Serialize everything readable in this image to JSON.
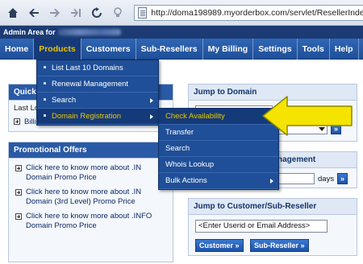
{
  "browser": {
    "url": "http://doma198989.myorderbox.com/servlet/ResellerIndexSe"
  },
  "admin_bar": {
    "label": "Admin Area for"
  },
  "nav": {
    "items": [
      "Home",
      "Products",
      "Customers",
      "Sub-Resellers",
      "My Billing",
      "Settings",
      "Tools",
      "Help"
    ]
  },
  "products_menu": {
    "items": [
      {
        "label": "List Last 10 Domains",
        "submenu": false
      },
      {
        "label": "Renewal Management",
        "submenu": false
      },
      {
        "label": "Search",
        "submenu": true
      },
      {
        "label": "Domain Registration",
        "submenu": true
      }
    ]
  },
  "domain_menu": {
    "items": [
      {
        "label": "Check Availability",
        "submenu": false
      },
      {
        "label": "Transfer",
        "submenu": false
      },
      {
        "label": "Search",
        "submenu": false
      },
      {
        "label": "Whois Lookup",
        "submenu": false
      },
      {
        "label": "Bulk Actions",
        "submenu": true
      }
    ]
  },
  "quick_panel": {
    "title": "Quick",
    "row1": "Last Lo",
    "row2": "Billing Summary"
  },
  "promo_panel": {
    "title": "Promotional Offers",
    "links": [
      "Click here to know more about .IN Domain Promo Price",
      "Click here to know more about .IN Domain (3rd Level) Promo Price",
      "Click here to know more about .INFO Domain Promo Price"
    ]
  },
  "jump_domain": {
    "title": "Jump to Domain",
    "go": "»"
  },
  "renewal_panel": {
    "title": "nagement",
    "unit": "days",
    "go": "»"
  },
  "jump_customer": {
    "title": "Jump to Customer/Sub-Reseller",
    "placeholder": "<Enter Userid or Email Address>",
    "customer_btn": "Customer »",
    "subreseller_btn": "Sub-Reseller »"
  },
  "colors": {
    "nav_bg": "#2f66b4",
    "menu_bg": "#1f4f98",
    "highlight": "#e9c600",
    "callout_arrow": "#f5e400"
  }
}
